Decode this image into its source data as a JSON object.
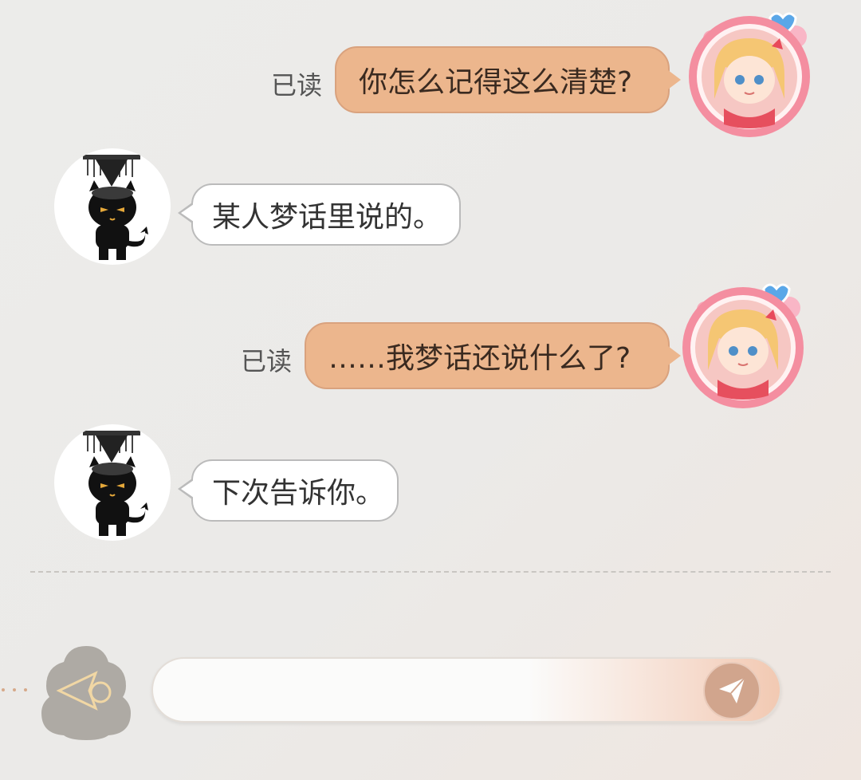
{
  "messages": [
    {
      "side": "out",
      "read_label": "已读",
      "text": "你怎么记得这么清楚?"
    },
    {
      "side": "in",
      "text": "某人梦话里说的。"
    },
    {
      "side": "out",
      "read_label": "已读",
      "text": "……我梦话还说什么了?"
    },
    {
      "side": "in",
      "text": "下次告诉你。"
    }
  ],
  "composer": {
    "placeholder": "",
    "value": ""
  },
  "icons": {
    "back": "back-arrow-icon",
    "send": "paper-plane-send-icon"
  },
  "colors": {
    "outgoing_bubble": "#ecb68d",
    "incoming_bubble": "#ffffff",
    "accent": "#d1a58d"
  }
}
